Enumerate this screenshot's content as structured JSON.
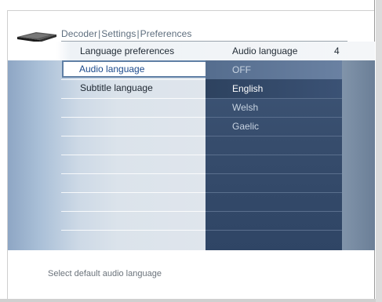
{
  "breadcrumb": {
    "items": [
      "Decoder",
      "Settings",
      "Preferences"
    ],
    "separator": "|"
  },
  "header": {
    "left_title": "Language preferences",
    "right_title": "Audio language",
    "right_count": "4"
  },
  "left_menu": {
    "items": [
      {
        "label": "Audio language",
        "selected": true
      },
      {
        "label": "Subtitle language",
        "selected": false
      }
    ]
  },
  "options": {
    "items": [
      {
        "label": "OFF",
        "highlighted": false
      },
      {
        "label": "English",
        "highlighted": true
      },
      {
        "label": "Welsh",
        "highlighted": false
      },
      {
        "label": "Gaelic",
        "highlighted": false
      }
    ]
  },
  "status": {
    "text": "Select default audio language"
  },
  "icons": {
    "device": "set-top-box-icon"
  },
  "colors": {
    "accent": "#1c4a8c",
    "panel_dark": "#364c6c",
    "selection_border": "#5f7fa5"
  }
}
